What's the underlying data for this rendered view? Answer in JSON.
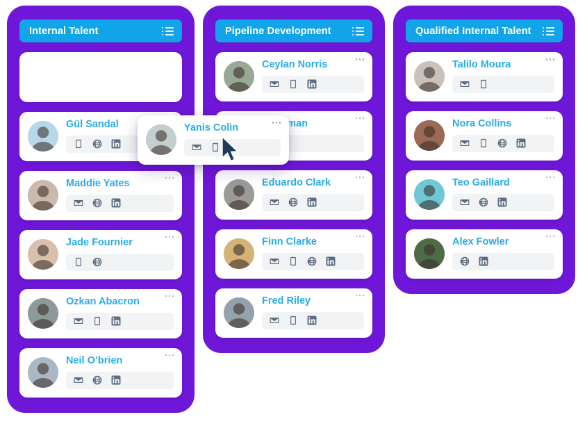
{
  "board": {
    "accent_header": "#12A4E8",
    "column_bg": "#6F17D8",
    "name_color": "#29ABE8",
    "icon_color": "#5C6B80",
    "menu_icon": "more-dots-icon",
    "header_icon": "list-icon"
  },
  "columns": [
    {
      "title": "Internal Talent",
      "cards": [
        {
          "name": "",
          "placeholder": true,
          "contacts": []
        },
        {
          "name": "Gül Sandal",
          "contacts": [
            "phone",
            "globe",
            "linkedin"
          ],
          "avatar_bg": "#b6d8ea"
        },
        {
          "name": "Maddie Yates",
          "contacts": [
            "mail",
            "globe",
            "linkedin"
          ],
          "avatar_bg": "#cbb9ad"
        },
        {
          "name": "Jade Fournier",
          "contacts": [
            "phone",
            "globe"
          ],
          "avatar_bg": "#d9c0ae"
        },
        {
          "name": "Özkan Abacron",
          "contacts": [
            "mail",
            "phone",
            "linkedin"
          ],
          "avatar_bg": "#8e9a99"
        },
        {
          "name": "Neil O’brien",
          "contacts": [
            "mail",
            "globe",
            "linkedin"
          ],
          "avatar_bg": "#aab7c4"
        }
      ]
    },
    {
      "title": "Pipeline Development",
      "cards": [
        {
          "name": "Ceylan Norris",
          "contacts": [
            "mail",
            "phone",
            "linkedin"
          ],
          "avatar_bg": "#9aa896"
        },
        {
          "name": "Chapman",
          "contacts": [
            "phone"
          ],
          "avatar_bg": "#c3ccd4",
          "occluded": true
        },
        {
          "name": "Eduardo Clark",
          "contacts": [
            "mail",
            "globe",
            "linkedin"
          ],
          "avatar_bg": "#9a9a9a"
        },
        {
          "name": "Finn Clarke",
          "contacts": [
            "mail",
            "phone",
            "globe",
            "linkedin"
          ],
          "avatar_bg": "#d3b378"
        },
        {
          "name": "Fred Riley",
          "contacts": [
            "mail",
            "phone",
            "linkedin"
          ],
          "avatar_bg": "#93a3ab"
        }
      ]
    },
    {
      "title": "Qualified Internal Talent",
      "cards": [
        {
          "name": "Talilo Moura",
          "contacts": [
            "mail",
            "phone"
          ],
          "avatar_bg": "#c9c2bc"
        },
        {
          "name": "Nora Collins",
          "contacts": [
            "mail",
            "phone",
            "globe",
            "linkedin"
          ],
          "avatar_bg": "#9b6a55"
        },
        {
          "name": "Teo Gaillard",
          "contacts": [
            "mail",
            "globe",
            "linkedin"
          ],
          "avatar_bg": "#6fc8d4"
        },
        {
          "name": "Alex Fowler",
          "contacts": [
            "globe",
            "linkedin"
          ],
          "avatar_bg": "#4e6b48"
        }
      ]
    }
  ],
  "drag_card": {
    "name": "Yanis Colin",
    "contacts": [
      "mail",
      "phone"
    ],
    "avatar_bg": "#c3cfcf",
    "cursor": "mouse-pointer-cursor"
  }
}
